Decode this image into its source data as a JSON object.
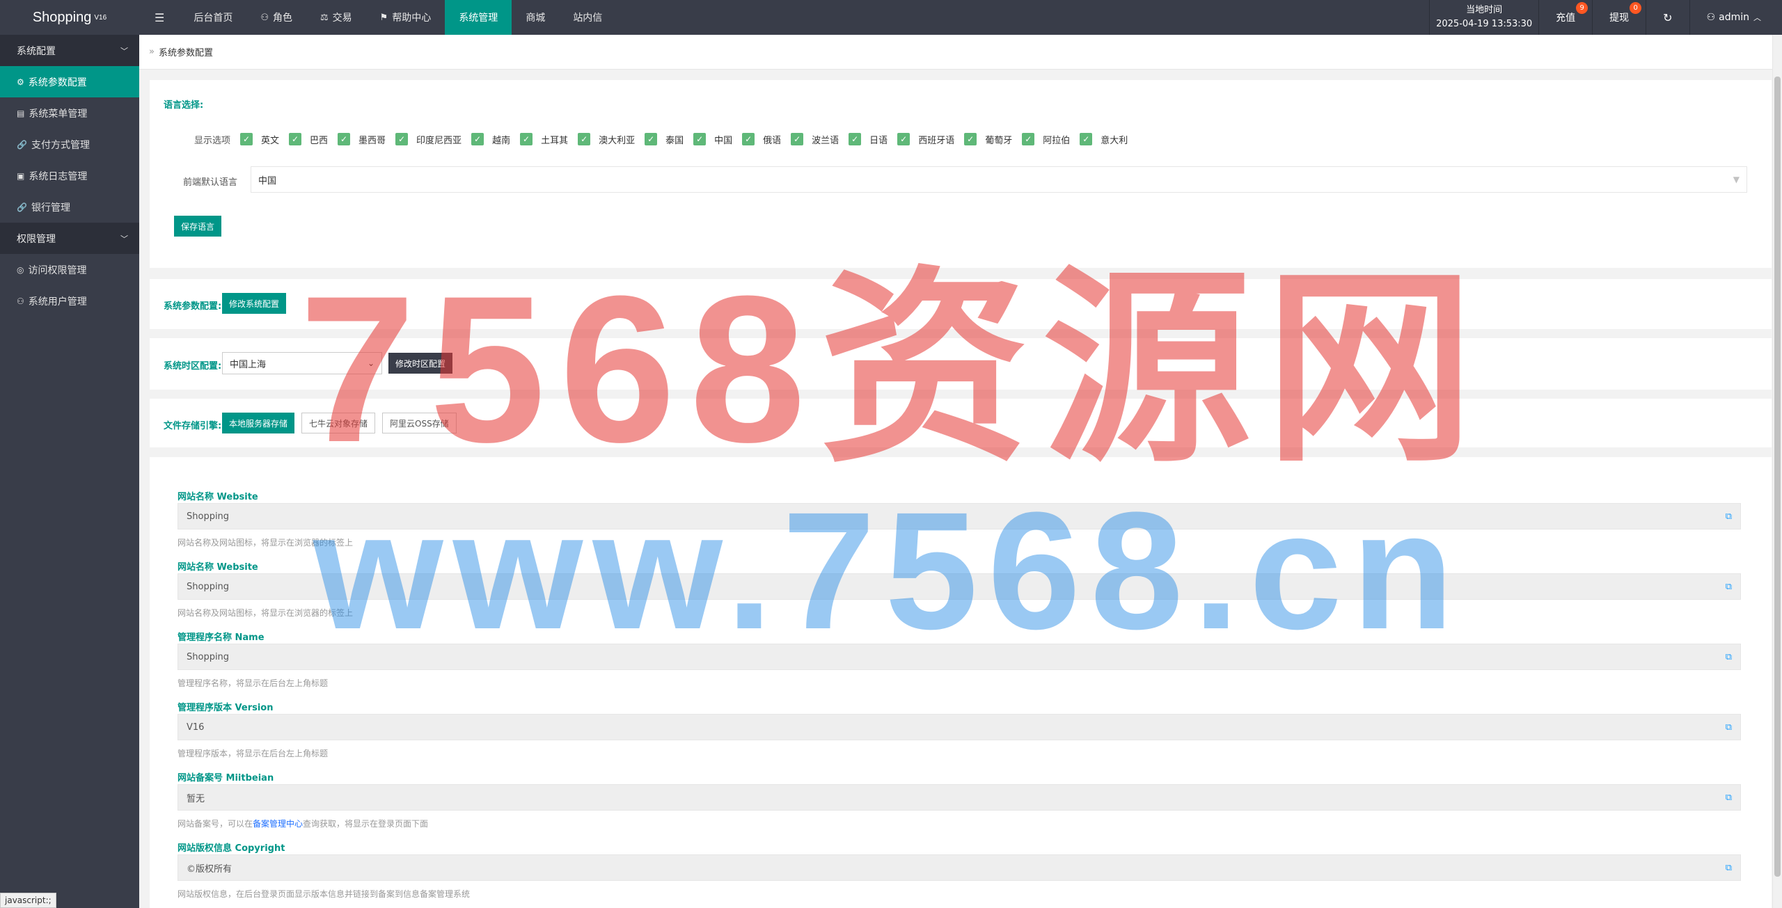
{
  "app": {
    "logo": "Shopping",
    "version": "V16"
  },
  "topnav": {
    "menu_toggle": "☰",
    "items": [
      {
        "label": "后台首页",
        "icon": ""
      },
      {
        "label": "角色",
        "icon": "user-icon"
      },
      {
        "label": "交易",
        "icon": "scale-icon"
      },
      {
        "label": "帮助中心",
        "icon": "flag-icon"
      },
      {
        "label": "系统管理",
        "icon": "",
        "active": true
      },
      {
        "label": "商城",
        "icon": ""
      },
      {
        "label": "站内信",
        "icon": ""
      }
    ]
  },
  "topright": {
    "clock_label": "当地时间",
    "clock_value": "2025-04-19 13:53:30",
    "recharge_label": "充值",
    "recharge_badge": "9",
    "withdraw_label": "提现",
    "withdraw_badge": "0",
    "refresh_icon": "refresh-icon",
    "user_label": "admin"
  },
  "sidebar": {
    "groups": [
      {
        "label": "系统配置",
        "items": [
          {
            "label": "系统参数配置",
            "icon": "gear-icon",
            "active": true
          },
          {
            "label": "系统菜单管理",
            "icon": "calendar-icon"
          },
          {
            "label": "支付方式管理",
            "icon": "link-icon"
          },
          {
            "label": "系统日志管理",
            "icon": "doc-icon"
          },
          {
            "label": "银行管理",
            "icon": "link-icon"
          }
        ]
      },
      {
        "label": "权限管理",
        "items": [
          {
            "label": "访问权限管理",
            "icon": "check-circle-icon"
          },
          {
            "label": "系统用户管理",
            "icon": "user-icon"
          }
        ]
      }
    ]
  },
  "breadcrumb": {
    "title": "系统参数配置"
  },
  "language": {
    "section_label": "语言选择:",
    "display_label": "显示选项",
    "options": [
      "英文",
      "巴西",
      "墨西哥",
      "印度尼西亚",
      "越南",
      "土耳其",
      "澳大利亚",
      "泰国",
      "中国",
      "俄语",
      "波兰语",
      "日语",
      "西班牙语",
      "葡萄牙",
      "阿拉伯",
      "意大利"
    ],
    "default_label": "前端默认语言",
    "default_value": "中国",
    "save_button": "保存语言"
  },
  "sysparam": {
    "label": "系统参数配置:",
    "button": "修改系统配置"
  },
  "timezone": {
    "label": "系统时区配置:",
    "value": "中国上海",
    "button": "修改时区配置"
  },
  "storage": {
    "label": "文件存储引擎:",
    "buttons": [
      "本地服务器存储",
      "七牛云对象存储",
      "阿里云OSS存储"
    ]
  },
  "fields": [
    {
      "label": "网站名称 Website",
      "value": "Shopping",
      "help": "网站名称及网站图标，将显示在浏览器的标签上"
    },
    {
      "label": "网站名称 Website",
      "value": "Shopping",
      "help": "网站名称及网站图标，将显示在浏览器的标签上"
    },
    {
      "label": "管理程序名称 Name",
      "value": "Shopping",
      "help": "管理程序名称，将显示在后台左上角标题"
    },
    {
      "label": "管理程序版本 Version",
      "value": "V16",
      "help": "管理程序版本，将显示在后台左上角标题"
    },
    {
      "label": "网站备案号 Miitbeian",
      "value": "暂无",
      "help_pre": "网站备案号，可以在",
      "help_link": "备案管理中心",
      "help_post": "查询获取，将显示在登录页面下面"
    },
    {
      "label": "网站版权信息 Copyright",
      "value": "©版权所有",
      "help": "网站版权信息，在后台登录页面显示版本信息并链接到备案到信息备案管理系统"
    }
  ],
  "statusbar": "javascript:;",
  "watermark": {
    "line1": "7568资源网",
    "line2": "www.7568.cn"
  }
}
